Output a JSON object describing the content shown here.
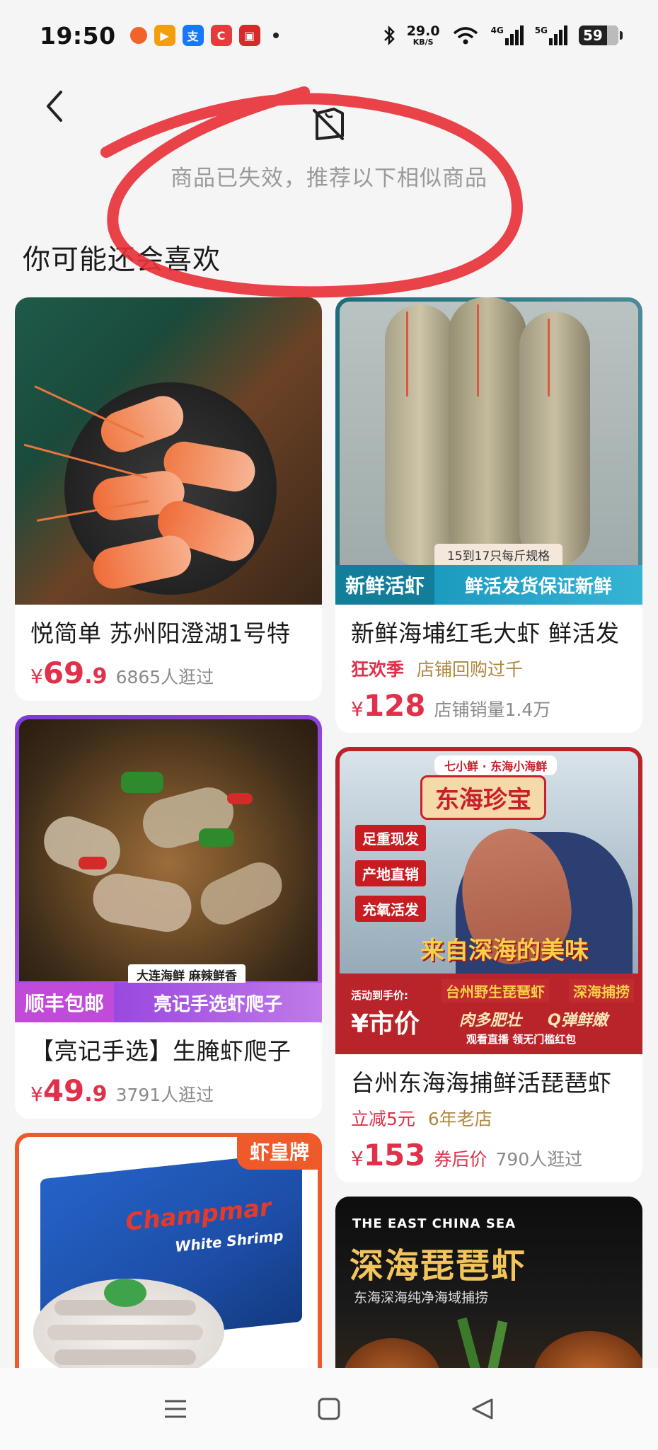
{
  "status_bar": {
    "time": "19:50",
    "net_speed_value": "29.0",
    "net_speed_unit": "KB/S",
    "signal_1": "4G",
    "signal_2": "5G",
    "battery": "59"
  },
  "header": {
    "invalid_message": "商品已失效，推荐以下相似商品"
  },
  "section": {
    "title": "你可能还会喜欢"
  },
  "products": [
    {
      "title": "悦简单 苏州阳澄湖1号特",
      "price_symbol": "¥",
      "price_int": "69",
      "price_dec": ".9",
      "sales": "6865人逛过"
    },
    {
      "title": "新鲜海埔红毛大虾 鲜活发",
      "tag_1": "狂欢季",
      "tag_2": "店铺回购过千",
      "price_symbol": "¥",
      "price_int": "128",
      "sales": "店铺销量1.4万",
      "img_spec": "15到17只每斤规格",
      "img_banner_left": "新鲜活虾",
      "img_banner_right": "鲜活发货保证新鲜"
    },
    {
      "title": "【亮记手选】生腌虾爬子",
      "price_symbol": "¥",
      "price_int": "49",
      "price_dec": ".9",
      "sales": "3791人逛过",
      "img_subtitle": "大连海鲜 麻辣鲜香",
      "img_banner_left": "顺丰包邮",
      "img_banner_right": "亮记手选虾爬子"
    },
    {
      "title": "台州东海海捕鲜活琵琶虾",
      "tag_1": "立减5元",
      "tag_2": "6年老店",
      "price_symbol": "¥",
      "price_int": "153",
      "price_suffix": "券后价",
      "sales": "790人逛过",
      "img_brand": "七小鲜 · 东海小海鲜",
      "img_heading": "东海珍宝",
      "img_chips": [
        "足重现发",
        "产地直销",
        "充氧活发"
      ],
      "img_slogan": "来自深海的美味",
      "img_price_label": "活动到手价:",
      "img_price": "¥市价",
      "img_feature_1": "台州野生琵琶虾",
      "img_feature_2": "深海捕捞",
      "img_feature_3": "肉多肥壮",
      "img_feature_4": "Q弹鲜嫩",
      "img_feature_5": "观看直播 领无门槛红包"
    },
    {
      "img_badge": "虾皇牌",
      "img_box_brand": "Champmar",
      "img_box_sub": "White Shrimp"
    },
    {
      "img_top": "THE EAST CHINA SEA",
      "img_heading": "深海琵琶虾",
      "img_sub": "东海深海纯净海域捕捞"
    }
  ]
}
